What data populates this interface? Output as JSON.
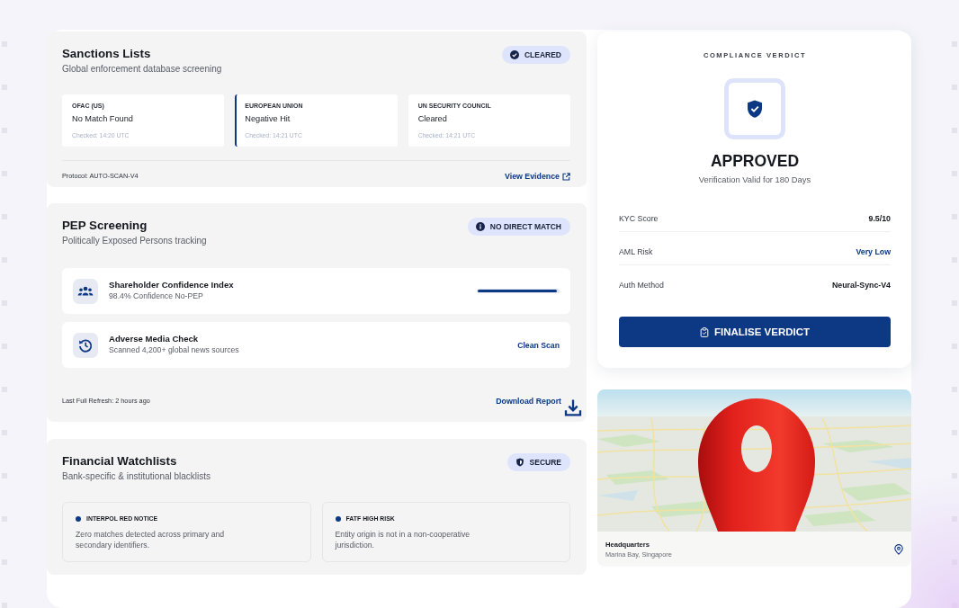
{
  "sanctions": {
    "title": "Sanctions Lists",
    "subtitle": "Global enforcement database screening",
    "badge": "CLEARED",
    "sources": [
      {
        "name": "OFAC (US)",
        "result": "No Match Found",
        "checked": "Checked: 14:20 UTC",
        "highlighted": false
      },
      {
        "name": "EUROPEAN UNION",
        "result": "Negative Hit",
        "checked": "Checked: 14:21 UTC",
        "highlighted": true
      },
      {
        "name": "UN SECURITY COUNCIL",
        "result": "Cleared",
        "checked": "Checked: 14:21 UTC",
        "highlighted": false
      }
    ],
    "protocol": "Protocol: AUTO-SCAN-V4",
    "link": "View Evidence"
  },
  "pep": {
    "title": "PEP Screening",
    "subtitle": "Politically Exposed Persons tracking",
    "badge": "NO DIRECT MATCH",
    "checks": [
      {
        "kind": "progress",
        "title": "Shareholder Confidence Index",
        "detail": "98.4% Confidence No-PEP",
        "level": 0.98
      },
      {
        "kind": "status",
        "title": "Adverse Media Check",
        "detail": "Scanned 4,200+ global news sources",
        "status": "Clean Scan"
      }
    ],
    "refresh": "Last Full Refresh: 2 hours ago",
    "link": "Download Report"
  },
  "watchlists": {
    "title": "Financial Watchlists",
    "subtitle": "Bank-specific & institutional blacklists",
    "badge": "SECURE",
    "lists": [
      {
        "name": "INTERPOL RED NOTICE",
        "description": "Zero matches detected across primary and secondary identifiers."
      },
      {
        "name": "FATF HIGH RISK",
        "description": "Entity origin is not in a non-cooperative jurisdiction."
      }
    ]
  },
  "verdict": {
    "heading": "COMPLIANCE VERDICT",
    "status": "APPROVED",
    "validity": "Verification Valid for 180 Days",
    "metrics": [
      {
        "label": "KYC Score",
        "value": "9.5/10",
        "highlighted": false
      },
      {
        "label": "AML Risk",
        "value": "Very Low",
        "highlighted": true
      },
      {
        "label": "Auth Method",
        "value": "Neural-Sync-V4",
        "highlighted": false
      }
    ],
    "button": "FINALISE VERDICT"
  },
  "location": {
    "title": "Headquarters",
    "address": "Marina Bay, Singapore"
  }
}
